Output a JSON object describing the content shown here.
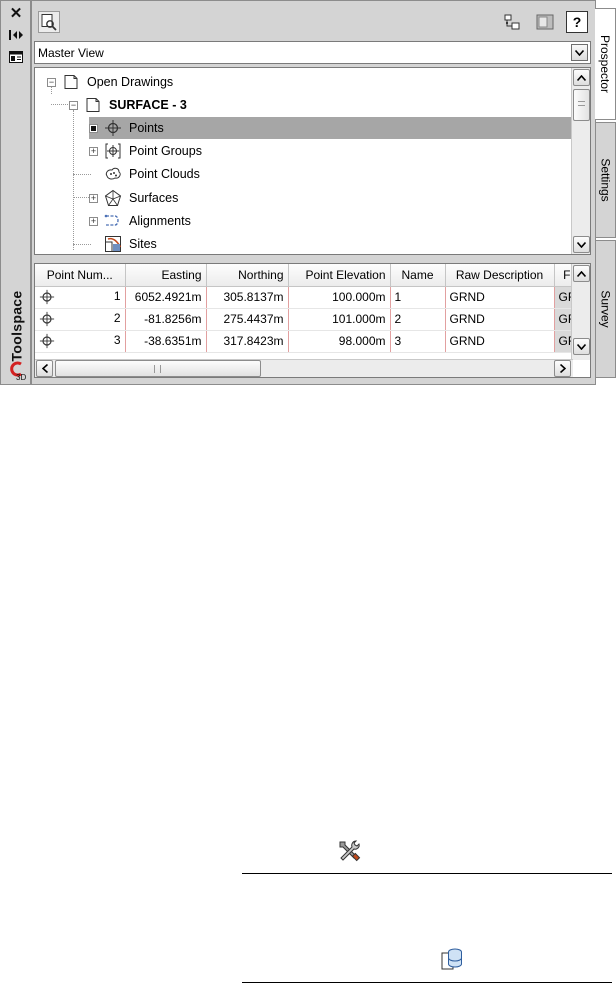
{
  "toolspace": {
    "label": "Toolspace"
  },
  "view_select": {
    "value": "Master View"
  },
  "tree": [
    {
      "label": "Open Drawings",
      "bold": false
    },
    {
      "label": "SURFACE - 3",
      "bold": true
    },
    {
      "label": "Points",
      "bold": false,
      "selected": true
    },
    {
      "label": "Point Groups",
      "bold": false
    },
    {
      "label": "Point Clouds",
      "bold": false
    },
    {
      "label": "Surfaces",
      "bold": false
    },
    {
      "label": "Alignments",
      "bold": false
    },
    {
      "label": "Sites",
      "bold": false
    }
  ],
  "table": {
    "headers": [
      "Point Num...",
      "Easting",
      "Northing",
      "Point Elevation",
      "Name",
      "Raw Description",
      "F"
    ],
    "rows": [
      [
        "1",
        "6052.4921m",
        "305.8137m",
        "100.000m",
        "1",
        "GRND",
        "GF"
      ],
      [
        "2",
        "-81.8256m",
        "275.4437m",
        "101.000m",
        "2",
        "GRND",
        "GF"
      ],
      [
        "3",
        "-38.6351m",
        "317.8423m",
        "98.000m",
        "3",
        "GRND",
        "GF"
      ]
    ]
  },
  "tabs": {
    "prospector": "Prospector",
    "settings": "Settings",
    "survey": "Survey"
  },
  "icons": {
    "close": "close-icon",
    "autohide": "auto-hide-icon",
    "properties": "properties-icon",
    "civil3d": "civil3d-logo-icon",
    "search": "search-icon",
    "item_view": "item-view-icon",
    "panel": "panel-icon",
    "help": "help-icon",
    "tools": "tools-icon",
    "database": "database-icon"
  },
  "colors": {
    "panel_bg": "#d4d4d4",
    "selected_row": "#a6a6a6",
    "logo_red": "#d32020"
  }
}
